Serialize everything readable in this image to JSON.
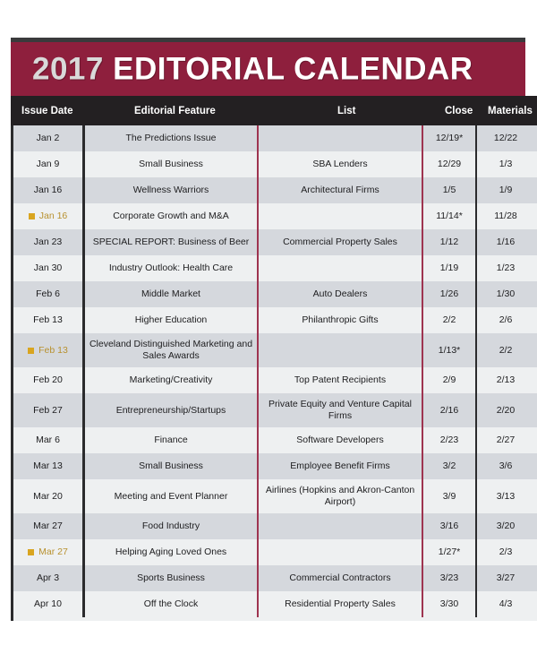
{
  "header": {
    "title_year": "2017",
    "title_rest": " EDITORIAL CALENDAR",
    "brand_color": "#8e1f3d",
    "highlight_color": "#d9a520"
  },
  "table": {
    "columns": [
      {
        "key": "issue_date",
        "label": "Issue Date"
      },
      {
        "key": "editorial_feature",
        "label": "Editorial Feature"
      },
      {
        "key": "list",
        "label": "List"
      },
      {
        "key": "close",
        "label": "Close"
      },
      {
        "key": "materials",
        "label": "Materials"
      }
    ],
    "rows": [
      {
        "issue_date": "Jan 2",
        "highlight": false,
        "editorial_feature": "The Predictions Issue",
        "list": "",
        "close": "12/19*",
        "materials": "12/22"
      },
      {
        "issue_date": "Jan 9",
        "highlight": false,
        "editorial_feature": "Small Business",
        "list": "SBA Lenders",
        "close": "12/29",
        "materials": "1/3"
      },
      {
        "issue_date": "Jan 16",
        "highlight": false,
        "editorial_feature": "Wellness Warriors",
        "list": "Architectural Firms",
        "close": "1/5",
        "materials": "1/9"
      },
      {
        "issue_date": "Jan 16",
        "highlight": true,
        "editorial_feature": "Corporate Growth and M&A",
        "list": "",
        "close": "11/14*",
        "materials": "11/28"
      },
      {
        "issue_date": "Jan 23",
        "highlight": false,
        "editorial_feature": "SPECIAL REPORT: Business of Beer",
        "list": "Commercial Property Sales",
        "close": "1/12",
        "materials": "1/16"
      },
      {
        "issue_date": "Jan 30",
        "highlight": false,
        "editorial_feature": "Industry Outlook: Health Care",
        "list": "",
        "close": "1/19",
        "materials": "1/23"
      },
      {
        "issue_date": "Feb 6",
        "highlight": false,
        "editorial_feature": "Middle Market",
        "list": "Auto Dealers",
        "close": "1/26",
        "materials": "1/30"
      },
      {
        "issue_date": "Feb 13",
        "highlight": false,
        "editorial_feature": "Higher Education",
        "list": "Philanthropic Gifts",
        "close": "2/2",
        "materials": "2/6"
      },
      {
        "issue_date": "Feb 13",
        "highlight": true,
        "editorial_feature": "Cleveland Distinguished Marketing and Sales Awards",
        "list": "",
        "close": "1/13*",
        "materials": "2/2",
        "two_line": true
      },
      {
        "issue_date": "Feb 20",
        "highlight": false,
        "editorial_feature": "Marketing/Creativity",
        "list": "Top Patent Recipients",
        "close": "2/9",
        "materials": "2/13"
      },
      {
        "issue_date": "Feb 27",
        "highlight": false,
        "editorial_feature": "Entrepreneurship/Startups",
        "list": "Private Equity and Venture Capital Firms",
        "close": "2/16",
        "materials": "2/20",
        "two_line": true
      },
      {
        "issue_date": "Mar 6",
        "highlight": false,
        "editorial_feature": "Finance",
        "list": "Software Developers",
        "close": "2/23",
        "materials": "2/27"
      },
      {
        "issue_date": "Mar 13",
        "highlight": false,
        "editorial_feature": "Small Business",
        "list": "Employee Benefit Firms",
        "close": "3/2",
        "materials": "3/6"
      },
      {
        "issue_date": "Mar 20",
        "highlight": false,
        "editorial_feature": "Meeting and Event Planner",
        "list": "Airlines (Hopkins and Akron-Canton Airport)",
        "close": "3/9",
        "materials": "3/13",
        "two_line": true
      },
      {
        "issue_date": "Mar 27",
        "highlight": false,
        "editorial_feature": "Food Industry",
        "list": "",
        "close": "3/16",
        "materials": "3/20"
      },
      {
        "issue_date": "Mar 27",
        "highlight": true,
        "editorial_feature": "Helping Aging Loved Ones",
        "list": "",
        "close": "1/27*",
        "materials": "2/3"
      },
      {
        "issue_date": "Apr 3",
        "highlight": false,
        "editorial_feature": "Sports Business",
        "list": "Commercial Contractors",
        "close": "3/23",
        "materials": "3/27"
      },
      {
        "issue_date": "Apr 10",
        "highlight": false,
        "editorial_feature": "Off the Clock",
        "list": "Residential Property Sales",
        "close": "3/30",
        "materials": "4/3"
      }
    ]
  }
}
